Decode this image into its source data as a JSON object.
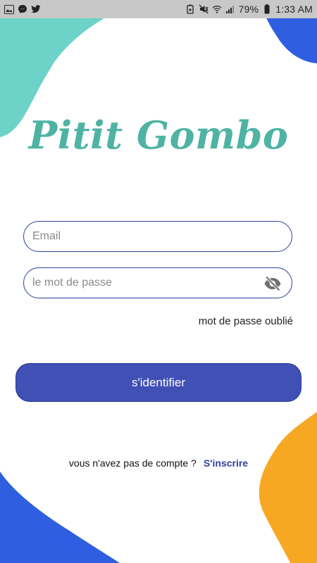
{
  "status_bar": {
    "battery_percent": "79%",
    "time": "1:33 AM",
    "left_icons": [
      "gallery-icon",
      "messenger-icon",
      "twitter-icon"
    ],
    "right_icons": [
      "battery-saver-icon",
      "mute-icon",
      "wifi-icon",
      "signal-icon",
      "battery-icon"
    ]
  },
  "app": {
    "logo_text": "Pitit Gombo"
  },
  "login_form": {
    "email_placeholder": "Email",
    "email_value": "",
    "password_placeholder": "le mot de passe",
    "password_value": "",
    "password_toggle_icon": "eye-off-icon",
    "forgot_password_label": "mot de passe oublié",
    "submit_label": "s'identifier"
  },
  "register": {
    "prompt": "vous n'avez pas de compte ?",
    "link_label": "S'inscrire"
  },
  "colors": {
    "accent": "#4150b5",
    "border": "#2f3f9e",
    "logo": "#4fb3a3",
    "teal_blob": "#6dd3c8",
    "blue_blob": "#2f5ee0",
    "orange_blob": "#f7a823"
  }
}
